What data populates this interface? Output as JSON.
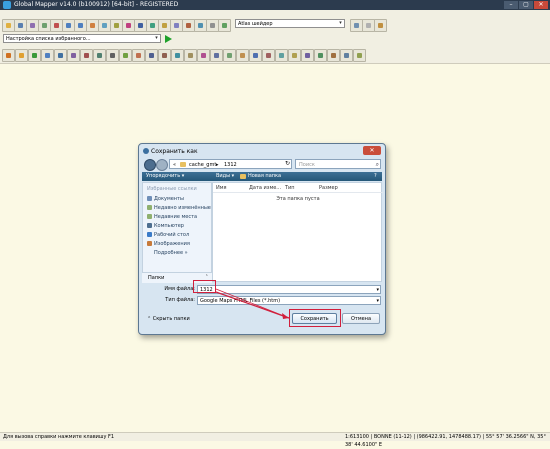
{
  "app": {
    "title": "Global Mapper v14.0 (b100912) [64-bit] - REGISTERED",
    "window_buttons": [
      "–",
      "▢",
      "✕"
    ]
  },
  "toolbar": {
    "layer_combo_value": "Настройка списка избранного...",
    "shader_combo_value": "Atlas шейдер"
  },
  "dialog": {
    "title": "Сохранить как",
    "close_glyph": "✕",
    "address": {
      "root": "«",
      "folder1": "cache_gmt",
      "sep": "▸",
      "folder2": "1312"
    },
    "search_placeholder": "Поиск",
    "toolbar": {
      "organize": "Упорядочить ▾",
      "views": "Виды ▾",
      "new_folder": "Новая папка",
      "help": "?"
    },
    "favorites_header": "Избранные ссылки",
    "sidebar_items": [
      {
        "label": "Документы",
        "icon": "documents-icon",
        "color": "#6f8fb8"
      },
      {
        "label": "Недавно изменённые",
        "icon": "recent-icon",
        "color": "#8fb06f"
      },
      {
        "label": "Недавние места",
        "icon": "recent-places-icon",
        "color": "#8fb06f"
      },
      {
        "label": "Компьютер",
        "icon": "computer-icon",
        "color": "#4d6e8f"
      },
      {
        "label": "Рабочий стол",
        "icon": "desktop-icon",
        "color": "#3a7bc8"
      },
      {
        "label": "Изображения",
        "icon": "pictures-icon",
        "color": "#c77a3a"
      },
      {
        "label": "Подробнее »",
        "icon": "",
        "color": ""
      }
    ],
    "folders_label": "Папки",
    "folders_chevron": "ˆ",
    "columns": [
      "Имя",
      "Дата изме...",
      "Тип",
      "Размер"
    ],
    "empty_text": "Эта папка пуста",
    "filename_label": "Имя файла:",
    "filename_value": "1312",
    "filetype_label": "Тип файла:",
    "filetype_value": "Google Maps HTML Files (*.htm)",
    "hide_folders_label": "Скрыть папки",
    "save_label": "Сохранить",
    "cancel_label": "Отмена"
  },
  "status": {
    "left": "Для вызова справки нажмите клавишу F1",
    "right": "1:613100 | BONNE (11-12) | (986422.91, 1478488.17) | 55° 57' 36.2566\" N, 35° 38' 44.6100\" E"
  }
}
